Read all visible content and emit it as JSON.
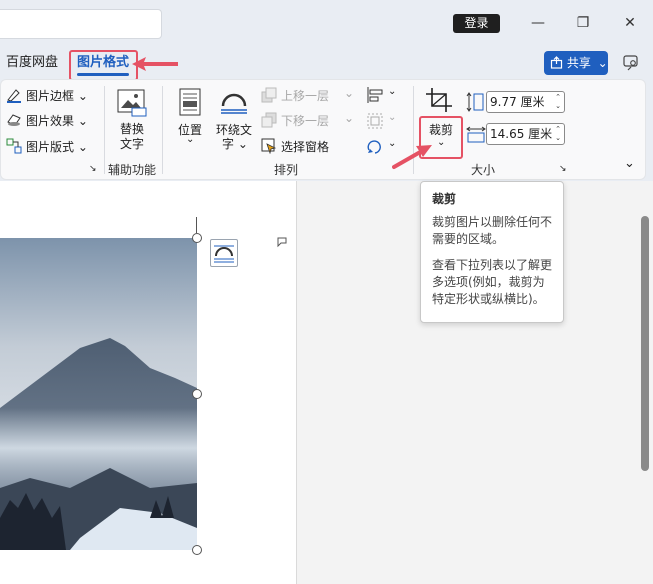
{
  "titlebar": {
    "login_label": "登录",
    "min_glyph": "—",
    "restore_glyph": "❐",
    "close_glyph": "✕"
  },
  "tabs": [
    {
      "label": "百度网盘",
      "active": false
    },
    {
      "label": "图片格式",
      "active": true
    }
  ],
  "share": {
    "label": "共享",
    "chevron": "⌄"
  },
  "ribbon": {
    "adjust": {
      "picture_border": "图片边框",
      "picture_effects": "图片效果",
      "picture_layout": "图片版式"
    },
    "accessibility": {
      "alt_text_line1": "替换",
      "alt_text_line2": "文字",
      "group_label": "辅助功能"
    },
    "arrange": {
      "position": "位置",
      "wrap_text_line1": "环绕文",
      "wrap_text_line2": "字",
      "bring_forward": "上移一层",
      "send_backward": "下移一层",
      "selection_pane": "选择窗格",
      "group_label": "排列"
    },
    "size": {
      "crop": "裁剪",
      "height_value": "9.77 厘米",
      "width_value": "14.65 厘米",
      "group_label": "大小"
    },
    "collapse_glyph": "⌄"
  },
  "tooltip": {
    "title": "裁剪",
    "para1": "裁剪图片以删除任何不需要的区域。",
    "para2": "查看下拉列表以了解更多选项(例如，裁剪为特定形状或纵横比)。"
  },
  "colors": {
    "accent": "#1f5fbf",
    "annotation_red": "#e55264",
    "ribbon_bg": "#f9f9fa",
    "chrome_bg": "#e9edf3"
  }
}
